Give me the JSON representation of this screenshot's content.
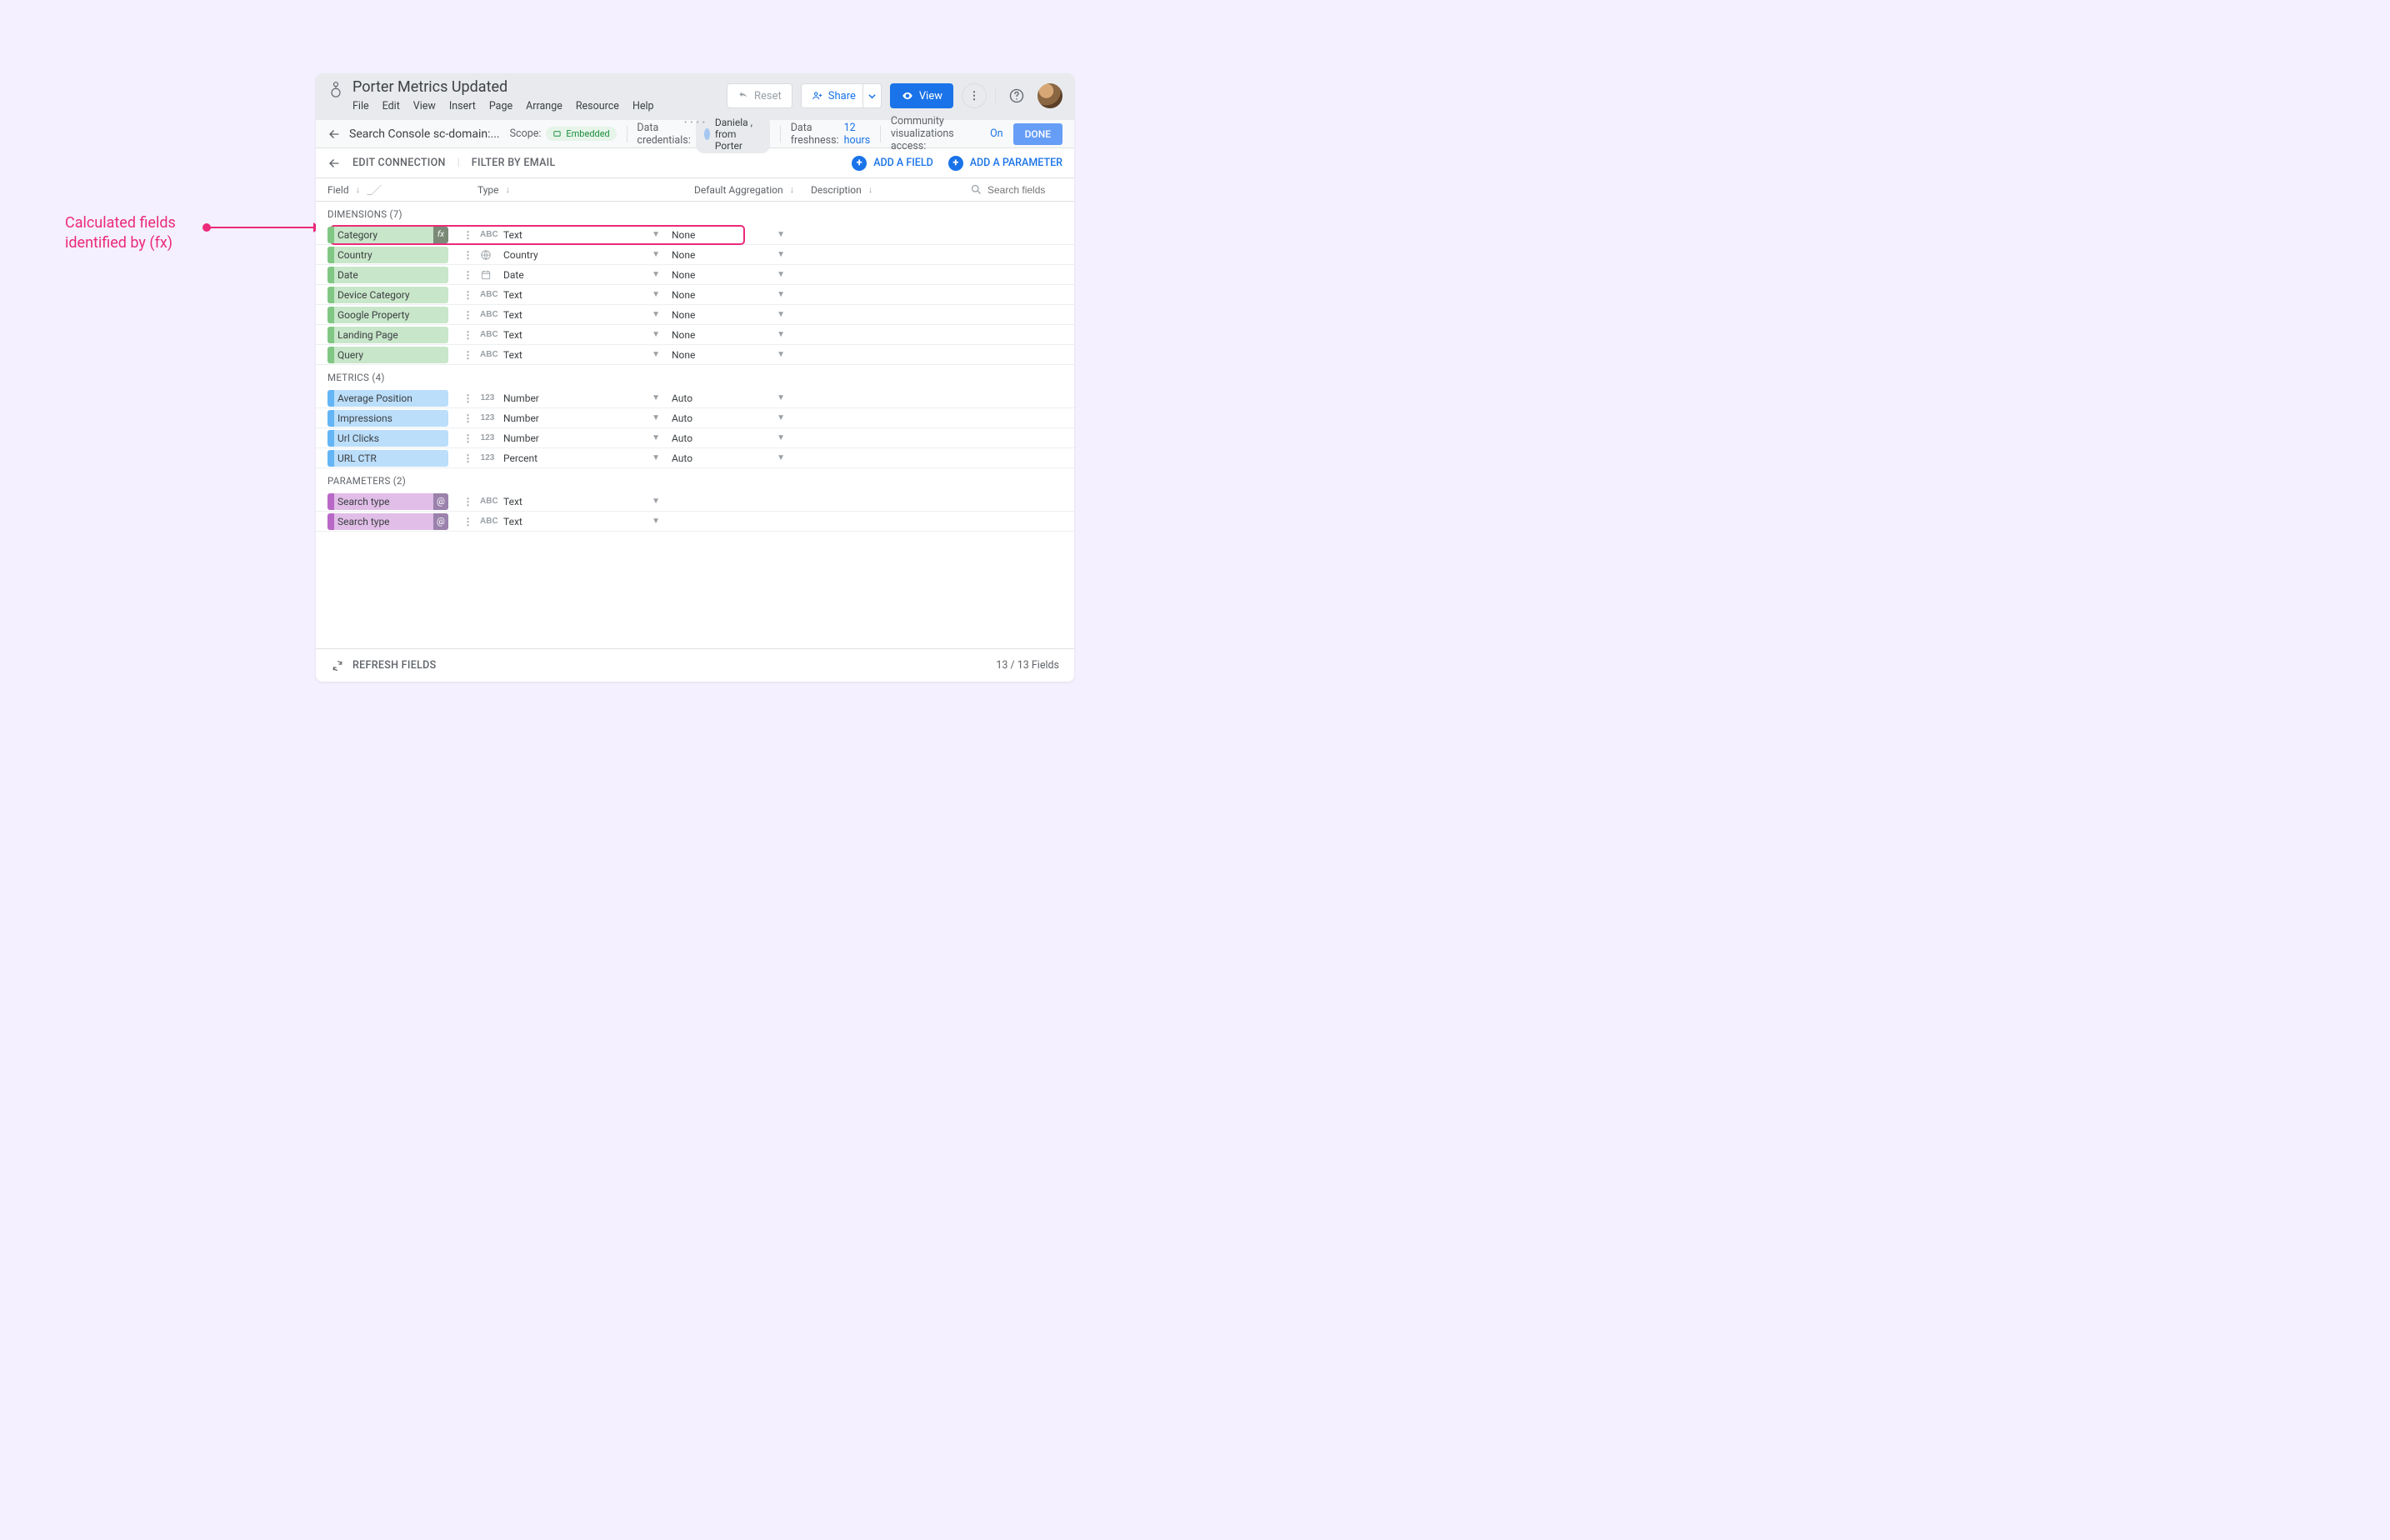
{
  "callout": {
    "line1": "Calculated fields",
    "line2": "identified by (fx)"
  },
  "header": {
    "title": "Porter Metrics Updated",
    "menu": [
      "File",
      "Edit",
      "View",
      "Insert",
      "Page",
      "Arrange",
      "Resource",
      "Help"
    ],
    "reset": "Reset",
    "share": "Share",
    "view": "View"
  },
  "crumb": {
    "breadcrumb": "Search Console sc-domain:...",
    "scope_lbl": "Scope:",
    "scope_val": "Embedded",
    "cred_lbl": "Data credentials:",
    "cred_val": "Daniela , from Porter",
    "fresh_lbl": "Data freshness:",
    "fresh_val": "12 hours",
    "viz_lbl": "Community visualizations access:",
    "viz_val": "On",
    "done": "DONE"
  },
  "toolbar": {
    "edit_conn": "EDIT CONNECTION",
    "filter": "FILTER BY EMAIL",
    "add_field": "ADD A FIELD",
    "add_param": "ADD A PARAMETER"
  },
  "cols": {
    "field": "Field",
    "type": "Type",
    "agg": "Default Aggregation",
    "desc": "Description",
    "search_ph": "Search fields"
  },
  "sections": {
    "dims": "DIMENSIONS (7)",
    "mets": "METRICS (4)",
    "pars": "PARAMETERS (2)"
  },
  "dims": [
    {
      "name": "Category",
      "icon": "abc",
      "type": "Text",
      "agg": "None",
      "fx": true
    },
    {
      "name": "Country",
      "icon": "globe",
      "type": "Country",
      "agg": "None"
    },
    {
      "name": "Date",
      "icon": "cal",
      "type": "Date",
      "agg": "None"
    },
    {
      "name": "Device Category",
      "icon": "abc",
      "type": "Text",
      "agg": "None"
    },
    {
      "name": "Google Property",
      "icon": "abc",
      "type": "Text",
      "agg": "None"
    },
    {
      "name": "Landing Page",
      "icon": "abc",
      "type": "Text",
      "agg": "None"
    },
    {
      "name": "Query",
      "icon": "abc",
      "type": "Text",
      "agg": "None"
    }
  ],
  "mets": [
    {
      "name": "Average Position",
      "icon": "num",
      "type": "Number",
      "agg": "Auto"
    },
    {
      "name": "Impressions",
      "icon": "num",
      "type": "Number",
      "agg": "Auto"
    },
    {
      "name": "Url Clicks",
      "icon": "num",
      "type": "Number",
      "agg": "Auto"
    },
    {
      "name": "URL CTR",
      "icon": "num",
      "type": "Percent",
      "agg": "Auto"
    }
  ],
  "pars": [
    {
      "name": "Search type",
      "icon": "abc",
      "type": "Text",
      "at": true
    },
    {
      "name": "Search type",
      "icon": "abc",
      "type": "Text",
      "at": true
    }
  ],
  "footer": {
    "refresh": "REFRESH FIELDS",
    "count": "13 / 13 Fields"
  }
}
